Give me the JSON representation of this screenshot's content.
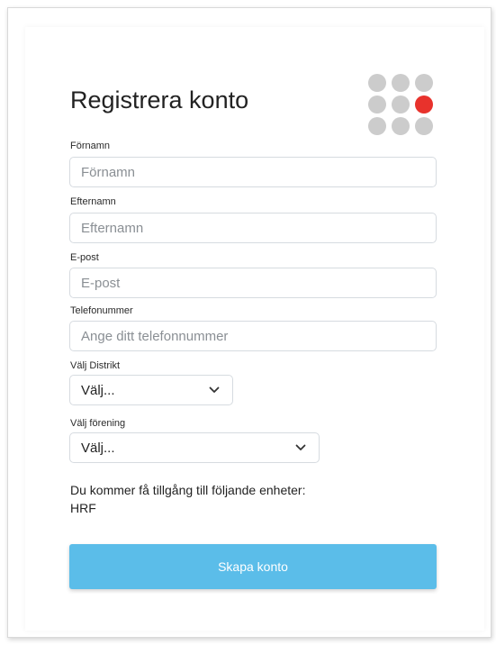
{
  "form": {
    "title": "Registrera konto",
    "fields": [
      {
        "label": "Förnamn",
        "placeholder": "Förnamn"
      },
      {
        "label": "Efternamn",
        "placeholder": "Efternamn"
      },
      {
        "label": "E-post",
        "placeholder": "E-post"
      },
      {
        "label": "Telefonummer",
        "placeholder": "Ange ditt telefonnummer"
      }
    ],
    "selects": [
      {
        "label": "Välj Distrikt",
        "value": "Välj..."
      },
      {
        "label": "Välj förening",
        "value": "Välj..."
      }
    ],
    "access_text": "Du kommer få tillgång till följande enheter:",
    "access_unit": "HRF",
    "submit_label": "Skapa konto"
  },
  "logo": {
    "icon": "dot-grid-logo",
    "dot_color": "#cccccc",
    "accent_color": "#e8322c"
  },
  "colors": {
    "button": "#5bbde9",
    "input_border": "#d6dbe0"
  }
}
